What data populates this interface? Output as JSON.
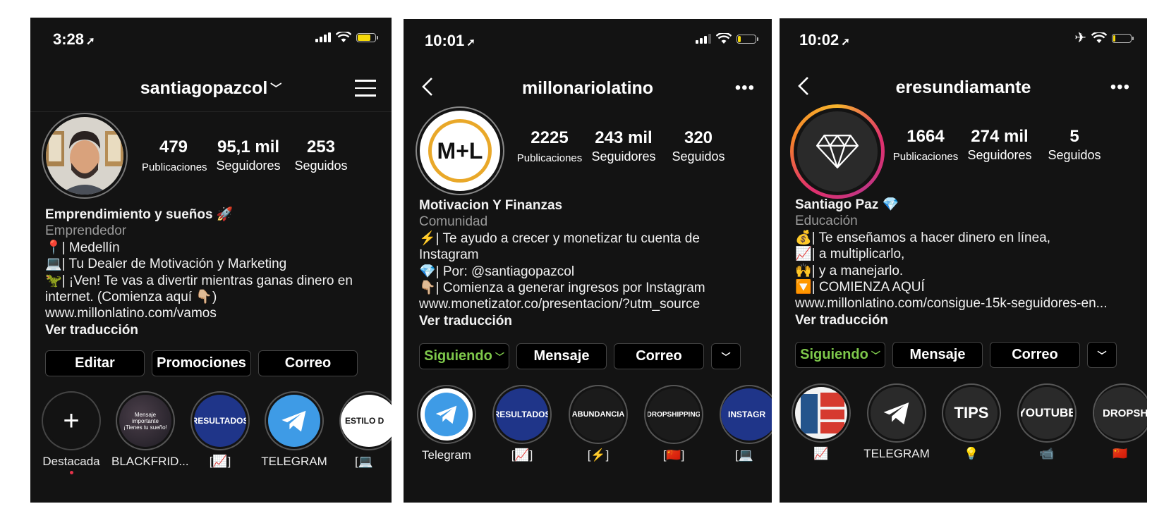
{
  "colors": {
    "bg": "#131313",
    "green": "#7ec84b",
    "muted": "#9a9a9a",
    "blue": "#3e9be6",
    "navy": "#1f3589"
  },
  "p1": {
    "time": "3:28",
    "username": "santiagopazcol",
    "stats": [
      {
        "num": "479",
        "label": "Publicaciones"
      },
      {
        "num": "95,1 mil",
        "label": "Seguidores"
      },
      {
        "num": "253",
        "label": "Seguidos"
      }
    ],
    "name": "Emprendimiento y sueños 🚀",
    "category": "Emprendedor",
    "lines": [
      "📍| Medellín",
      "💻| Tu Dealer de Motivación y Marketing",
      "🦖| ¡Ven! Te vas a divertir mientras ganas dinero en",
      "internet. (Comienza aquí 👇🏼)",
      "www.millonlatino.com/vamos"
    ],
    "translate": "Ver traducción",
    "buttons": [
      "Editar",
      "Promociones",
      "Correo"
    ],
    "highlights": [
      {
        "label": "Destacada",
        "icon": "plus-icon"
      },
      {
        "label": "BLACKFRID...",
        "text": "Mensaje importante ¡Tienes tu sueño!"
      },
      {
        "label": "[📈]",
        "text": "RESULTADOS"
      },
      {
        "label": "TELEGRAM",
        "icon": "telegram-icon"
      },
      {
        "label": "[💻",
        "text": "ESTILO D"
      }
    ]
  },
  "p2": {
    "time": "10:01",
    "username": "millonariolatino",
    "avatar_text": "M+L",
    "stats": [
      {
        "num": "2225",
        "label": "Publicaciones"
      },
      {
        "num": "243 mil",
        "label": "Seguidores"
      },
      {
        "num": "320",
        "label": "Seguidos"
      }
    ],
    "name": "Motivacion Y Finanzas",
    "category": "Comunidad",
    "lines": [
      "⚡| Te ayudo a crecer y monetizar tu cuenta de",
      "Instagram",
      "💎| Por: @santiagopazcol",
      "👇🏼| Comienza a generar ingresos por Instagram",
      "www.monetizator.co/presentacion/?utm_source"
    ],
    "translate": "Ver traducción",
    "buttons": [
      "Siguiendo",
      "Mensaje",
      "Correo"
    ],
    "highlights": [
      {
        "label": "Telegram",
        "icon": "telegram-icon"
      },
      {
        "label": "[📈]",
        "text": "RESULTADOS"
      },
      {
        "label": "[⚡]",
        "text": "ABUNDANCIA"
      },
      {
        "label": "[🇨🇳]",
        "text": "DROPSHIPPING"
      },
      {
        "label": "[💻",
        "text": "INSTAGR"
      }
    ]
  },
  "p3": {
    "time": "10:02",
    "username": "eresundiamante",
    "stats": [
      {
        "num": "1664",
        "label": "Publicaciones"
      },
      {
        "num": "274 mil",
        "label": "Seguidores"
      },
      {
        "num": "5",
        "label": "Seguidos"
      }
    ],
    "name": "Santiago Paz 💎",
    "category": "Educación",
    "lines": [
      "💰| Te enseñamos a hacer dinero en línea,",
      "📈| a multiplicarlo,",
      "🙌| y a manejarlo.",
      "🔽| COMIENZA AQUÍ",
      "www.millonlatino.com/consigue-15k-seguidores-en..."
    ],
    "translate": "Ver traducción",
    "buttons": [
      "Siguiendo",
      "Mensaje",
      "Correo"
    ],
    "highlights": [
      {
        "label": "📈",
        "icon": "book-cover-icon"
      },
      {
        "label": "TELEGRAM",
        "icon": "telegram-icon"
      },
      {
        "label": "💡",
        "text": "TIPS"
      },
      {
        "label": "📹",
        "text": "YOUTUBE"
      },
      {
        "label": "🇨🇳",
        "text": "DROPSHI"
      }
    ]
  }
}
